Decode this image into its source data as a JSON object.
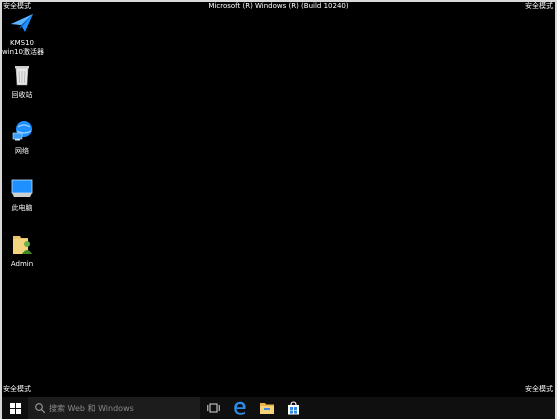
{
  "screen": {
    "mode_label": "安全模式",
    "title": "Microsoft (R) Windows (R) (Build 10240)"
  },
  "desktop_icons": [
    {
      "label_line1": "KMS10",
      "label_line2": "win10激活器"
    },
    {
      "label": "回收站"
    },
    {
      "label": "网络"
    },
    {
      "label": "此电脑"
    },
    {
      "label": "Admin"
    }
  ],
  "taskbar": {
    "search_placeholder": "搜索 Web 和 Windows",
    "buttons": [
      "start",
      "task-view",
      "edge",
      "file-explorer",
      "store"
    ]
  },
  "colors": {
    "desktop_bg": "#000000",
    "accent_blue": "#1e90ff",
    "frame": "#d9d9d9"
  }
}
